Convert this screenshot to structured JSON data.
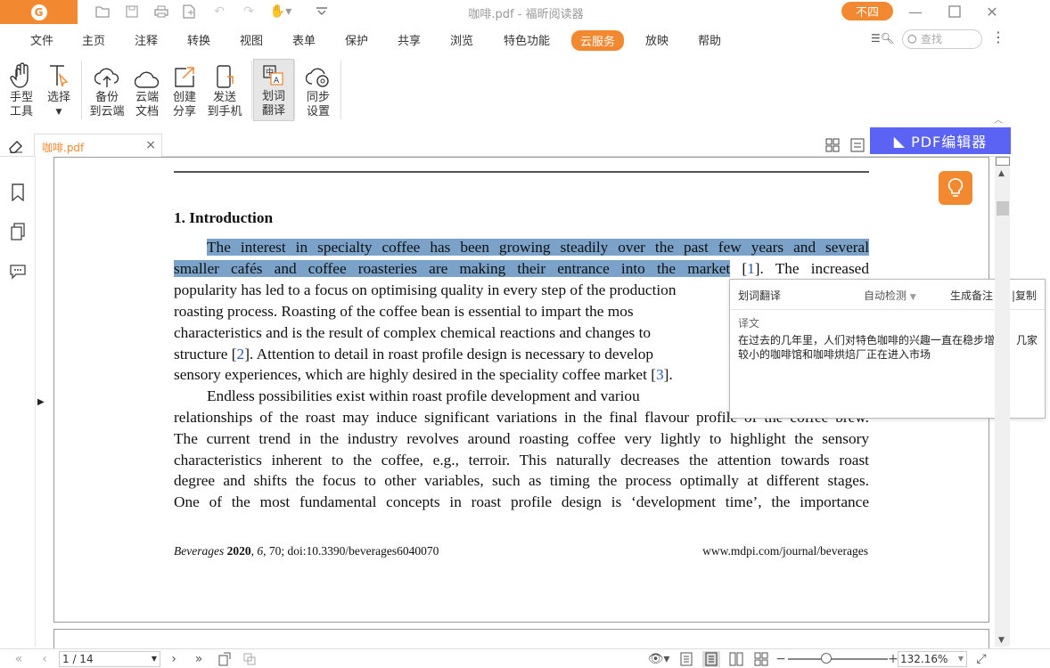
{
  "titlebar": {
    "window_title": "咖啡.pdf - 福昕阅读器",
    "user_button": "不四",
    "logo_glyph": "G"
  },
  "menu": [
    "文件",
    "主页",
    "注释",
    "转换",
    "视图",
    "表单",
    "保护",
    "共享",
    "浏览",
    "特色功能",
    "云服务",
    "放映",
    "帮助"
  ],
  "menu_active": "云服务",
  "search": {
    "placeholder": "查找"
  },
  "toolbar": [
    {
      "line1": "手型",
      "line2": "工具"
    },
    {
      "line1": "选择",
      "line2": ""
    },
    {
      "line1": "备份",
      "line2": "到云端"
    },
    {
      "line1": "云端",
      "line2": "文档"
    },
    {
      "line1": "创建",
      "line2": "分享"
    },
    {
      "line1": "发送",
      "line2": "到手机"
    },
    {
      "line1": "划词",
      "line2": "翻译"
    },
    {
      "line1": "同步",
      "line2": "设置"
    }
  ],
  "tab": {
    "label": "咖啡.pdf",
    "close": "×"
  },
  "pdf_editor": "PDF编辑器",
  "document": {
    "heading": "1. Introduction",
    "lines": [
      {
        "pre": "",
        "hl": "The interest in specialty coffee has been growing steadily over the past few years and several",
        "post": "",
        "ref": "",
        "post2": ""
      },
      {
        "pre": "",
        "hl": "smaller cafés and coffee roasteries are making their entrance into the market",
        "post": " [",
        "ref": "1",
        "post2": "].  The increased"
      },
      {
        "pre": "popularity has led to a focus on optimising quality in every step of the production",
        "hl": "",
        "post": "",
        "ref": "",
        "post2": ""
      },
      {
        "pre": "roasting process.  Roasting of the coffee bean is essential to impart the mos",
        "hl": "",
        "post": "",
        "ref": "",
        "post2": ""
      },
      {
        "pre": "characteristics and is the result of complex chemical reactions and changes to",
        "hl": "",
        "post": "",
        "ref": "",
        "post2": ""
      },
      {
        "pre": "structure [",
        "hl": "",
        "post": "",
        "ref": "2",
        "post2": "].  Attention to detail in roast profile design is necessary to develop"
      },
      {
        "pre": "sensory experiences, which are highly desired in the speciality coffee market [",
        "hl": "",
        "post": "",
        "ref": "3",
        "post2": "]."
      },
      {
        "pre": "Endless possibilities exist within roast profile development and variou",
        "hl": "",
        "post": "",
        "ref": "",
        "post2": ""
      },
      {
        "pre": "relationships of the roast may induce significant variations in the final flavour profile of the coffee brew.",
        "hl": "",
        "post": "",
        "ref": "",
        "post2": ""
      },
      {
        "pre": "The current trend in the industry revolves around roasting coffee very lightly to highlight the sensory",
        "hl": "",
        "post": "",
        "ref": "",
        "post2": ""
      },
      {
        "pre": "characteristics inherent to the coffee, e.g., terroir.  This naturally decreases the attention towards roast",
        "hl": "",
        "post": "",
        "ref": "",
        "post2": ""
      },
      {
        "pre": "degree and shifts the focus to other variables, such as timing the process optimally at different stages.",
        "hl": "",
        "post": "",
        "ref": "",
        "post2": ""
      },
      {
        "pre": "One of the most fundamental concepts in roast profile design is ‘development time’, the importance",
        "hl": "",
        "post": "",
        "ref": "",
        "post2": ""
      }
    ],
    "footer_journal": "Beverages",
    "footer_year": "2020",
    "footer_rest_a": ", ",
    "footer_vol": "6",
    "footer_rest_b": ", 70; doi:10.3390/beverages6040070",
    "footer_url": "www.mdpi.com/journal/beverages"
  },
  "translate_popup": {
    "title": "划词翻译",
    "auto_detect": "自动检测",
    "gen_note": "生成备注",
    "help": "?",
    "copy": "复制",
    "label": "译文",
    "text": "在过去的几年里，人们对特色咖啡的兴趣一直在稳步增长，几家较小的咖啡馆和咖啡烘焙厂正在进入市场"
  },
  "status": {
    "page": "1 / 14",
    "zoom": "132.16%",
    "zoom_level": 0.38
  },
  "colors": {
    "accent": "#f28830",
    "highlight": "#7ba3c9",
    "pdf_editor_bg": "#5b63f5"
  }
}
